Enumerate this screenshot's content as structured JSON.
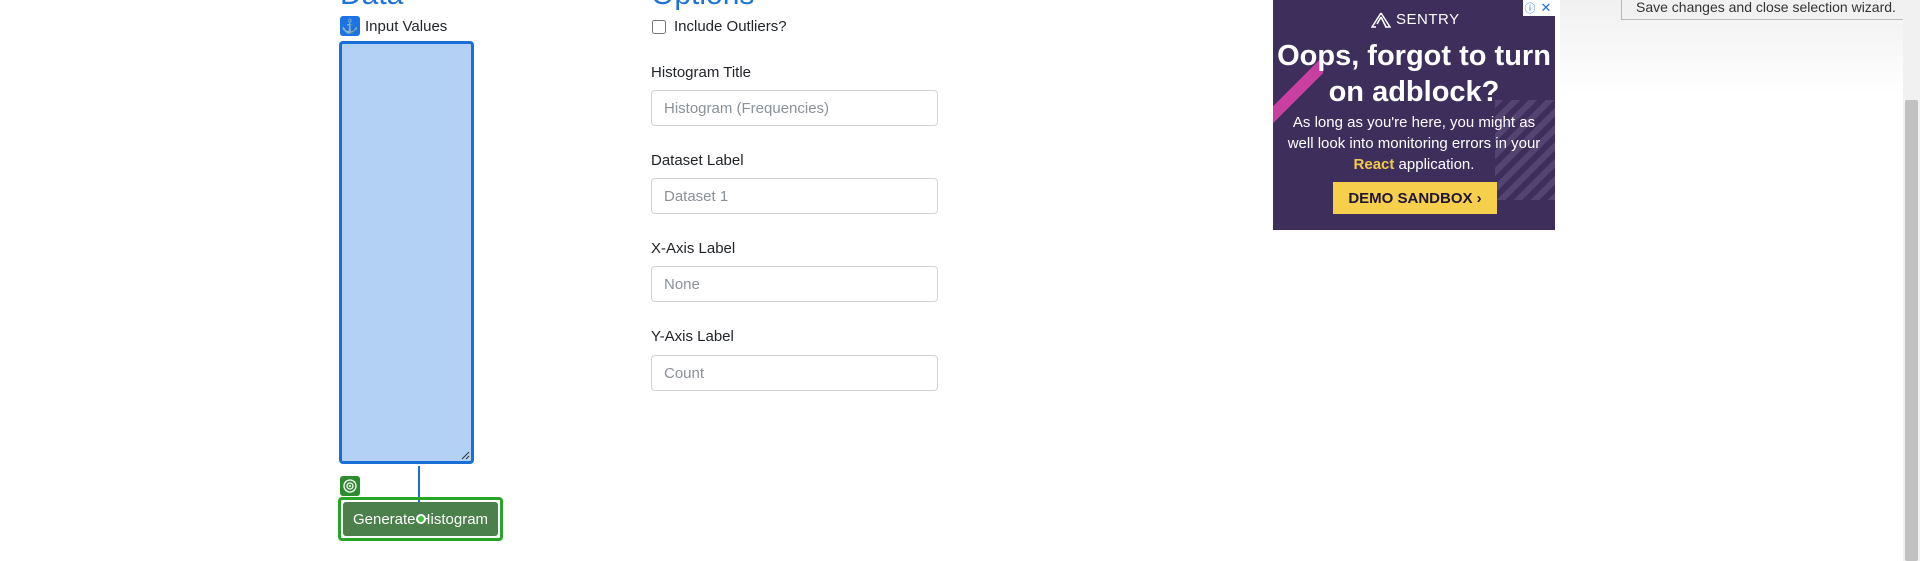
{
  "data_section": {
    "heading": "Data",
    "input_label": "Input Values",
    "generate_label": "Generate Histogram"
  },
  "options_section": {
    "heading": "Options",
    "outliers_label": "Include Outliers?",
    "outliers_checked": false,
    "fields": [
      {
        "label": "Histogram Title",
        "placeholder": "Histogram (Frequencies)",
        "value": ""
      },
      {
        "label": "Dataset Label",
        "placeholder": "Dataset 1",
        "value": ""
      },
      {
        "label": "X-Axis Label",
        "placeholder": "None",
        "value": ""
      },
      {
        "label": "Y-Axis Label",
        "placeholder": "Count",
        "value": ""
      }
    ]
  },
  "ad": {
    "brand": "SENTRY",
    "headline": "Oops, forgot to turn on adblock?",
    "body_pre": "As long as you're here, you might as well look into monitoring errors in your ",
    "body_highlight": "React",
    "body_post": " application.",
    "cta": "DEMO SANDBOX ›",
    "info_icon": "ⓘ",
    "close_icon": "✕",
    "colors": {
      "background": "#3d2e5c",
      "accent": "#f6d04d",
      "stripe": "#c83fa0"
    }
  },
  "tooltip": {
    "text": "Save changes and close selection wizard."
  },
  "colors": {
    "heading": "#1e73d9",
    "selection_blue": "#1a6fd6",
    "selection_green": "#28a428"
  }
}
